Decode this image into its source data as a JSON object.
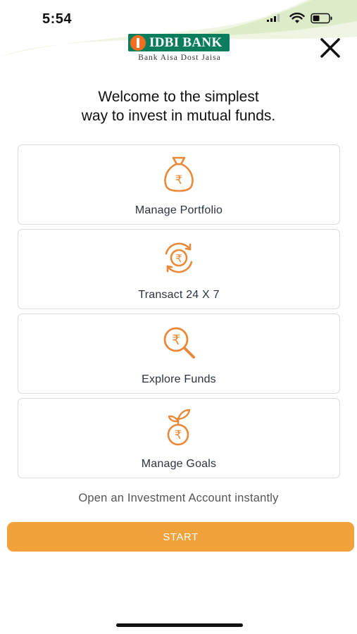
{
  "status_bar": {
    "time": "5:54",
    "icons": [
      "signal-icon",
      "wifi-icon",
      "battery-icon"
    ]
  },
  "header": {
    "logo_text": "IDBI BANK",
    "tagline": "Bank Aisa Dost Jaisa",
    "close_icon": "close-icon"
  },
  "welcome": {
    "line1": "Welcome to the simplest",
    "line2": "way to invest in mutual funds."
  },
  "cards": [
    {
      "label": "Manage Portfolio",
      "icon": "money-bag-icon"
    },
    {
      "label": "Transact 24 X 7",
      "icon": "rupee-cycle-icon"
    },
    {
      "label": "Explore Funds",
      "icon": "rupee-search-icon"
    },
    {
      "label": "Manage Goals",
      "icon": "rupee-plant-icon"
    }
  ],
  "open_account_text": "Open an Investment Account instantly",
  "start_label": "START",
  "colors": {
    "accent": "#f2a23a",
    "icon": "#e8893a",
    "brand_green": "#0a7d5c",
    "brand_orange": "#f26f21"
  }
}
